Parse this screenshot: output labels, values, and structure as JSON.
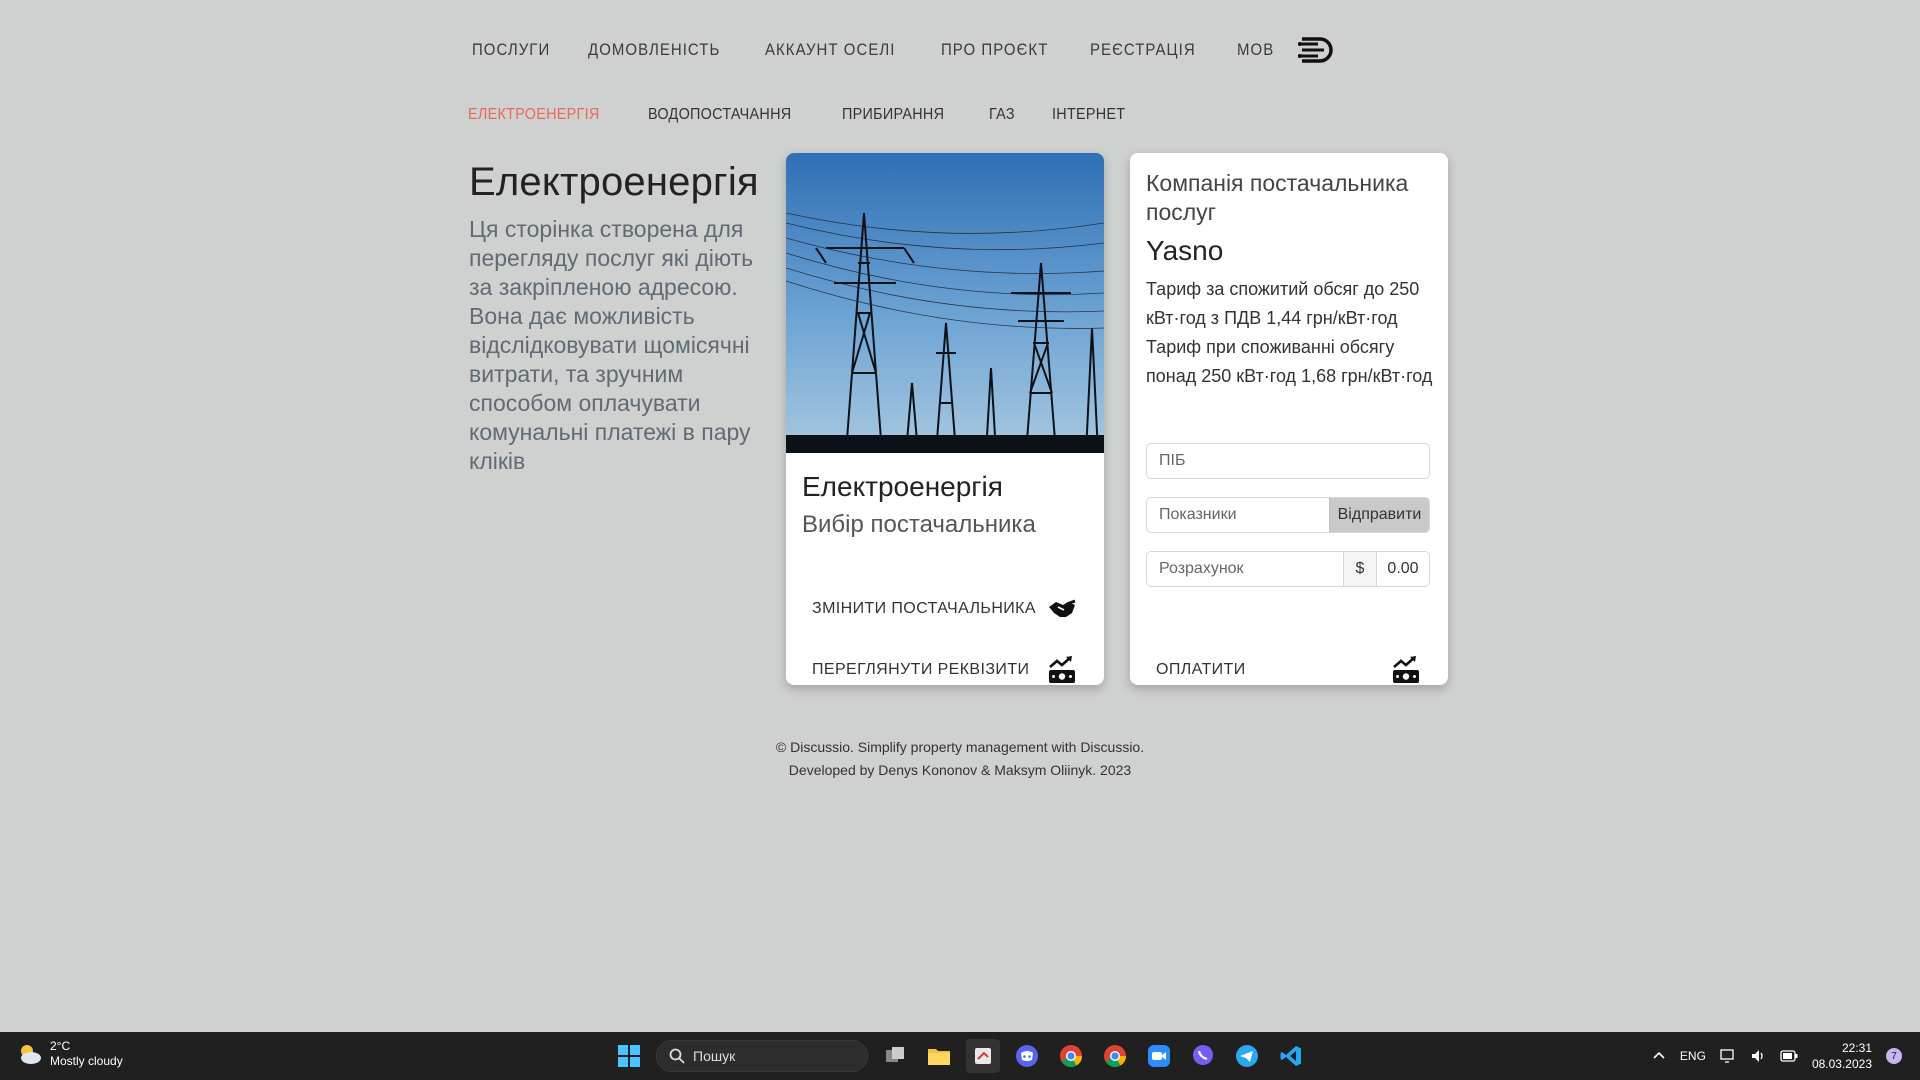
{
  "nav": {
    "items": [
      "ПОСЛУГИ",
      "ДОМОВЛЕНІСТЬ",
      "АККАУНТ ОСЕЛІ",
      "ПРО ПРОЄКТ",
      "РЕЄСТРАЦІЯ",
      "МОВ"
    ]
  },
  "subnav": {
    "items": [
      "ЕЛЕКТРОЕНЕРГІЯ",
      "ВОДОПОСТАЧАННЯ",
      "ПРИБИРАННЯ",
      "ГАЗ",
      "ІНТЕРНЕТ"
    ],
    "active_color": "#e86a5a"
  },
  "intro": {
    "title": "Електроенергія",
    "text": "Ця сторінка створена для перегляду послуг які діють за закріпленою адресою. Вона дає можливість відслідковувати щомісячні витрати, та зручним способом оплачувати комунальні платежі в пару кліків"
  },
  "service_card": {
    "title": "Електроенергія",
    "subtitle": "Вибір постачальника",
    "change_label": "ЗМІНИТИ ПОСТАЧАЛЬНИКА",
    "details_label": "ПЕРЕГЛЯНУТИ РЕКВІЗИТИ",
    "change_icon": "handshake-icon",
    "details_icon": "money-chart-icon"
  },
  "provider_card": {
    "company_label": "Компанія постачальника послуг",
    "company_name": "Yasno",
    "tariff_1": "Тариф за спожитий обсяг до 250 кВт·год з ПДВ 1,44 грн/кВт·год",
    "tariff_2": "Тариф при споживанні обсягу понад 250 кВт·год 1,68 грн/кВт·год",
    "name_placeholder": "ПІБ",
    "meter_placeholder": "Показники",
    "send_label": "Відправити",
    "calc_placeholder": "Розрахунок",
    "currency": "$",
    "amount": "0.00",
    "pay_label": "ОПЛАТИТИ",
    "pay_icon": "money-chart-icon"
  },
  "footer": {
    "line1": "© Discussio. Simplify property management with Discussio.",
    "line2": "Developed by Denys Kononov & Maksym Oliinyk. 2023"
  },
  "taskbar": {
    "temp": "2°C",
    "weather": "Mostly cloudy",
    "search_placeholder": "Пошук",
    "lang": "ENG",
    "time": "22:31",
    "date": "08.03.2023",
    "notifications": "7"
  }
}
